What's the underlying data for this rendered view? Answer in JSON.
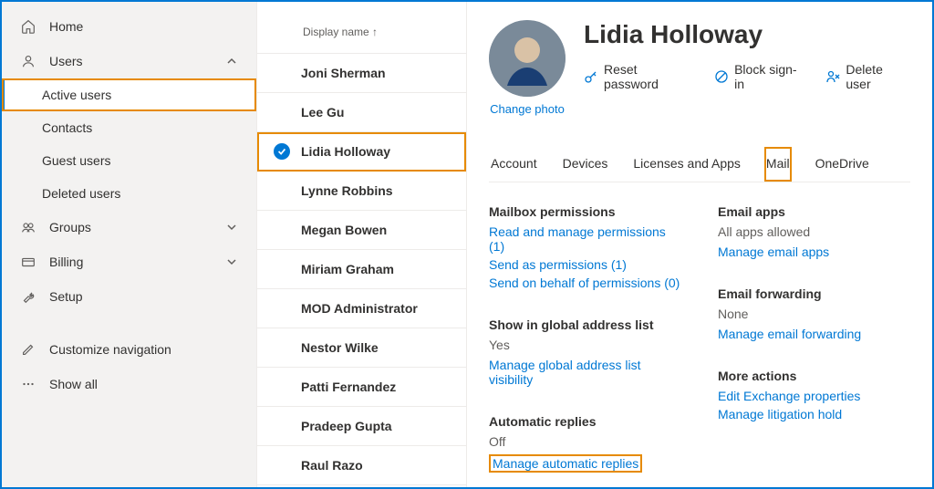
{
  "sidebar": {
    "home": "Home",
    "users": "Users",
    "users_children": [
      "Active users",
      "Contacts",
      "Guest users",
      "Deleted users"
    ],
    "groups": "Groups",
    "billing": "Billing",
    "setup": "Setup",
    "customize": "Customize navigation",
    "showall": "Show all"
  },
  "list": {
    "header": "Display name ↑",
    "rows": [
      "Joni Sherman",
      "Lee Gu",
      "Lidia Holloway",
      "Lynne Robbins",
      "Megan Bowen",
      "Miriam Graham",
      "MOD Administrator",
      "Nestor Wilke",
      "Patti Fernandez",
      "Pradeep Gupta",
      "Raul Razo"
    ]
  },
  "detail": {
    "name": "Lidia Holloway",
    "change_photo": "Change photo",
    "actions": {
      "reset": "Reset password",
      "block": "Block sign-in",
      "delete": "Delete user"
    },
    "tabs": [
      "Account",
      "Devices",
      "Licenses and Apps",
      "Mail",
      "OneDrive"
    ],
    "mailbox": {
      "title": "Mailbox permissions",
      "read": "Read and manage permissions (1)",
      "sendas": "Send as permissions (1)",
      "sendbehalf": "Send on behalf of permissions (0)"
    },
    "gal": {
      "title": "Show in global address list",
      "value": "Yes",
      "link": "Manage global address list visibility"
    },
    "autoreply": {
      "title": "Automatic replies",
      "value": "Off",
      "link": "Manage automatic replies"
    },
    "emailapps": {
      "title": "Email apps",
      "value": "All apps allowed",
      "link": "Manage email apps"
    },
    "forwarding": {
      "title": "Email forwarding",
      "value": "None",
      "link": "Manage email forwarding"
    },
    "more": {
      "title": "More actions",
      "edit": "Edit Exchange properties",
      "lit": "Manage litigation hold"
    }
  }
}
